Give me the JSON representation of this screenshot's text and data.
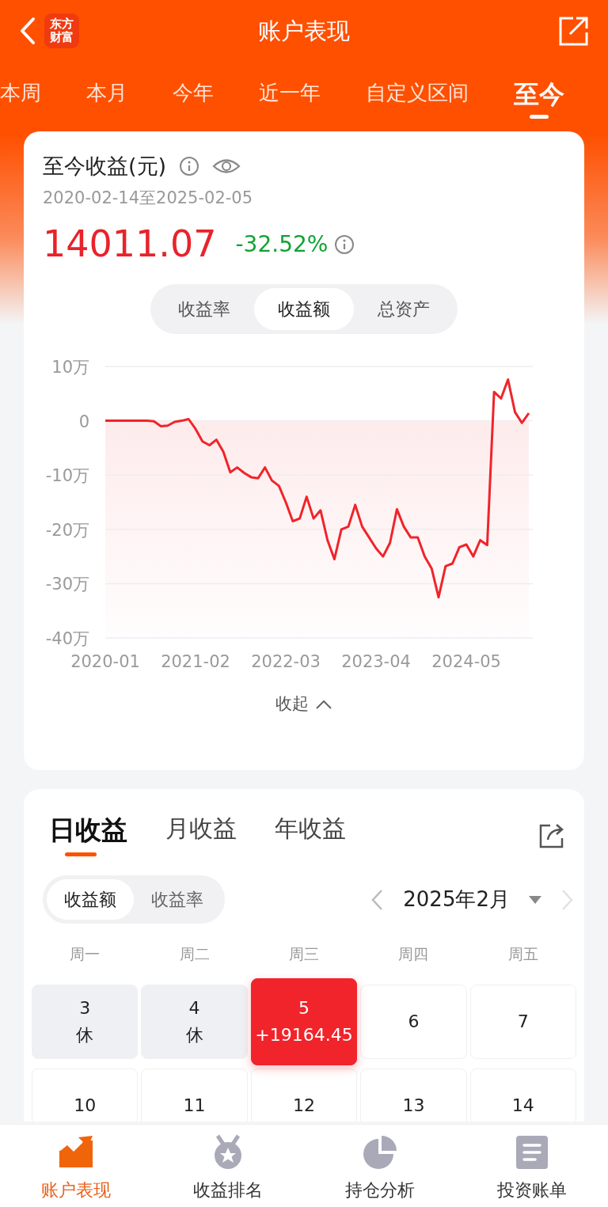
{
  "header": {
    "logo_lines": [
      "东方",
      "财富"
    ],
    "title": "账户表现"
  },
  "period_tabs": [
    {
      "label": "本周",
      "selected": false
    },
    {
      "label": "本月",
      "selected": false
    },
    {
      "label": "今年",
      "selected": false
    },
    {
      "label": "近一年",
      "selected": false
    },
    {
      "label": "自定义区间",
      "selected": false
    },
    {
      "label": "至今",
      "selected": true
    }
  ],
  "summary": {
    "title": "至今收益(元)",
    "date_range": "2020-02-14至2025-02-05",
    "amount": "14011.07",
    "rate": "-32.52%",
    "segments": [
      {
        "label": "收益率",
        "selected": false
      },
      {
        "label": "收益额",
        "selected": true
      },
      {
        "label": "总资产",
        "selected": false
      }
    ],
    "chart_data": {
      "type": "line",
      "grid": true,
      "categories": [
        "2020-01",
        null,
        null,
        null,
        null,
        null,
        null,
        null,
        null,
        null,
        null,
        null,
        null,
        "2021-02",
        null,
        null,
        null,
        null,
        null,
        null,
        null,
        null,
        null,
        null,
        null,
        null,
        "2022-03",
        null,
        null,
        null,
        null,
        null,
        null,
        null,
        null,
        null,
        null,
        null,
        null,
        "2023-04",
        null,
        null,
        null,
        null,
        null,
        null,
        null,
        null,
        null,
        null,
        null,
        null,
        "2024-05",
        null,
        null,
        null,
        null,
        null,
        null,
        null,
        null,
        null
      ],
      "series": [
        {
          "color": "#f0242a",
          "values": [
            0,
            0,
            0,
            0,
            0,
            0,
            0,
            -0.1,
            -1.0,
            -0.9,
            -0.2,
            0,
            0.3,
            -1.5,
            -3.8,
            -4.5,
            -3.5,
            -5.7,
            -9.5,
            -8.6,
            -9.6,
            -10.4,
            -10.6,
            -8.6,
            -11,
            -12,
            -15,
            -18.5,
            -18,
            -14,
            -18,
            -16.5,
            -22,
            -25.5,
            -20,
            -19.5,
            -15.5,
            -19.5,
            -21.5,
            -23.5,
            -25,
            -22.5,
            -16.3,
            -19.5,
            -21.5,
            -21.5,
            -25,
            -27.2,
            -32.5,
            -26.8,
            -26.3,
            -23.3,
            -22.8,
            -25,
            -22,
            -22.9,
            5.3,
            4.1,
            7.6,
            1.6,
            -0.4,
            1.4
          ]
        }
      ],
      "ylim": [
        -40,
        10
      ],
      "yticks": [
        {
          "value": 10,
          "label": "10万"
        },
        {
          "value": 0,
          "label": "0"
        },
        {
          "value": -10,
          "label": "-10万"
        },
        {
          "value": -20,
          "label": "-20万"
        },
        {
          "value": -30,
          "label": "-30万"
        },
        {
          "value": -40,
          "label": "-40万"
        }
      ]
    },
    "collapse_label": "收起"
  },
  "daily": {
    "tabs": [
      {
        "label": "日收益",
        "selected": true
      },
      {
        "label": "月收益",
        "selected": false
      },
      {
        "label": "年收益",
        "selected": false
      }
    ],
    "toggle": [
      {
        "label": "收益额",
        "selected": true
      },
      {
        "label": "收益率",
        "selected": false
      }
    ],
    "month": "2025年2月",
    "next_disabled": true,
    "weekdays": [
      "周一",
      "周二",
      "周三",
      "周四",
      "周五"
    ],
    "days": [
      {
        "day": "3",
        "note": "休",
        "rest": true,
        "selected": false
      },
      {
        "day": "4",
        "note": "休",
        "rest": true,
        "selected": false
      },
      {
        "day": "5",
        "note": "+19164.45",
        "rest": false,
        "selected": true
      },
      {
        "day": "6",
        "rest": false,
        "selected": false
      },
      {
        "day": "7",
        "rest": false,
        "selected": false
      },
      {
        "day": "10",
        "rest": false,
        "selected": false
      },
      {
        "day": "11",
        "rest": false,
        "selected": false
      },
      {
        "day": "12",
        "rest": false,
        "selected": false
      },
      {
        "day": "13",
        "rest": false,
        "selected": false
      },
      {
        "day": "14",
        "rest": false,
        "selected": false
      }
    ]
  },
  "bottom_nav": [
    {
      "kind": "trend",
      "label": "账户表现",
      "selected": true
    },
    {
      "kind": "medal",
      "label": "收益排名",
      "selected": false
    },
    {
      "kind": "pie",
      "label": "持仓分析",
      "selected": false
    },
    {
      "kind": "doc",
      "label": "投资账单",
      "selected": false
    }
  ]
}
